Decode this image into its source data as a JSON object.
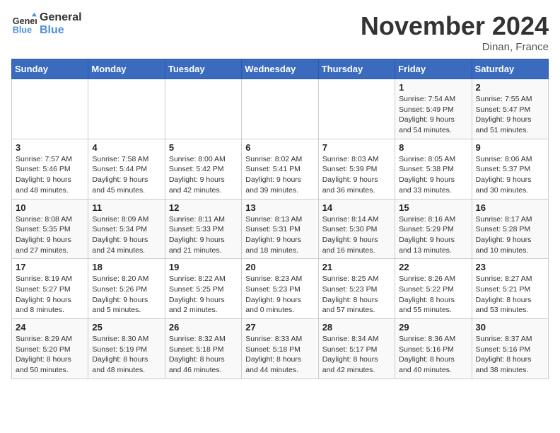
{
  "logo": {
    "line1": "General",
    "line2": "Blue"
  },
  "title": "November 2024",
  "location": "Dinan, France",
  "days_of_week": [
    "Sunday",
    "Monday",
    "Tuesday",
    "Wednesday",
    "Thursday",
    "Friday",
    "Saturday"
  ],
  "weeks": [
    [
      {
        "day": "",
        "info": ""
      },
      {
        "day": "",
        "info": ""
      },
      {
        "day": "",
        "info": ""
      },
      {
        "day": "",
        "info": ""
      },
      {
        "day": "",
        "info": ""
      },
      {
        "day": "1",
        "info": "Sunrise: 7:54 AM\nSunset: 5:49 PM\nDaylight: 9 hours and 54 minutes."
      },
      {
        "day": "2",
        "info": "Sunrise: 7:55 AM\nSunset: 5:47 PM\nDaylight: 9 hours and 51 minutes."
      }
    ],
    [
      {
        "day": "3",
        "info": "Sunrise: 7:57 AM\nSunset: 5:46 PM\nDaylight: 9 hours and 48 minutes."
      },
      {
        "day": "4",
        "info": "Sunrise: 7:58 AM\nSunset: 5:44 PM\nDaylight: 9 hours and 45 minutes."
      },
      {
        "day": "5",
        "info": "Sunrise: 8:00 AM\nSunset: 5:42 PM\nDaylight: 9 hours and 42 minutes."
      },
      {
        "day": "6",
        "info": "Sunrise: 8:02 AM\nSunset: 5:41 PM\nDaylight: 9 hours and 39 minutes."
      },
      {
        "day": "7",
        "info": "Sunrise: 8:03 AM\nSunset: 5:39 PM\nDaylight: 9 hours and 36 minutes."
      },
      {
        "day": "8",
        "info": "Sunrise: 8:05 AM\nSunset: 5:38 PM\nDaylight: 9 hours and 33 minutes."
      },
      {
        "day": "9",
        "info": "Sunrise: 8:06 AM\nSunset: 5:37 PM\nDaylight: 9 hours and 30 minutes."
      }
    ],
    [
      {
        "day": "10",
        "info": "Sunrise: 8:08 AM\nSunset: 5:35 PM\nDaylight: 9 hours and 27 minutes."
      },
      {
        "day": "11",
        "info": "Sunrise: 8:09 AM\nSunset: 5:34 PM\nDaylight: 9 hours and 24 minutes."
      },
      {
        "day": "12",
        "info": "Sunrise: 8:11 AM\nSunset: 5:33 PM\nDaylight: 9 hours and 21 minutes."
      },
      {
        "day": "13",
        "info": "Sunrise: 8:13 AM\nSunset: 5:31 PM\nDaylight: 9 hours and 18 minutes."
      },
      {
        "day": "14",
        "info": "Sunrise: 8:14 AM\nSunset: 5:30 PM\nDaylight: 9 hours and 16 minutes."
      },
      {
        "day": "15",
        "info": "Sunrise: 8:16 AM\nSunset: 5:29 PM\nDaylight: 9 hours and 13 minutes."
      },
      {
        "day": "16",
        "info": "Sunrise: 8:17 AM\nSunset: 5:28 PM\nDaylight: 9 hours and 10 minutes."
      }
    ],
    [
      {
        "day": "17",
        "info": "Sunrise: 8:19 AM\nSunset: 5:27 PM\nDaylight: 9 hours and 8 minutes."
      },
      {
        "day": "18",
        "info": "Sunrise: 8:20 AM\nSunset: 5:26 PM\nDaylight: 9 hours and 5 minutes."
      },
      {
        "day": "19",
        "info": "Sunrise: 8:22 AM\nSunset: 5:25 PM\nDaylight: 9 hours and 2 minutes."
      },
      {
        "day": "20",
        "info": "Sunrise: 8:23 AM\nSunset: 5:23 PM\nDaylight: 9 hours and 0 minutes."
      },
      {
        "day": "21",
        "info": "Sunrise: 8:25 AM\nSunset: 5:23 PM\nDaylight: 8 hours and 57 minutes."
      },
      {
        "day": "22",
        "info": "Sunrise: 8:26 AM\nSunset: 5:22 PM\nDaylight: 8 hours and 55 minutes."
      },
      {
        "day": "23",
        "info": "Sunrise: 8:27 AM\nSunset: 5:21 PM\nDaylight: 8 hours and 53 minutes."
      }
    ],
    [
      {
        "day": "24",
        "info": "Sunrise: 8:29 AM\nSunset: 5:20 PM\nDaylight: 8 hours and 50 minutes."
      },
      {
        "day": "25",
        "info": "Sunrise: 8:30 AM\nSunset: 5:19 PM\nDaylight: 8 hours and 48 minutes."
      },
      {
        "day": "26",
        "info": "Sunrise: 8:32 AM\nSunset: 5:18 PM\nDaylight: 8 hours and 46 minutes."
      },
      {
        "day": "27",
        "info": "Sunrise: 8:33 AM\nSunset: 5:18 PM\nDaylight: 8 hours and 44 minutes."
      },
      {
        "day": "28",
        "info": "Sunrise: 8:34 AM\nSunset: 5:17 PM\nDaylight: 8 hours and 42 minutes."
      },
      {
        "day": "29",
        "info": "Sunrise: 8:36 AM\nSunset: 5:16 PM\nDaylight: 8 hours and 40 minutes."
      },
      {
        "day": "30",
        "info": "Sunrise: 8:37 AM\nSunset: 5:16 PM\nDaylight: 8 hours and 38 minutes."
      }
    ]
  ]
}
